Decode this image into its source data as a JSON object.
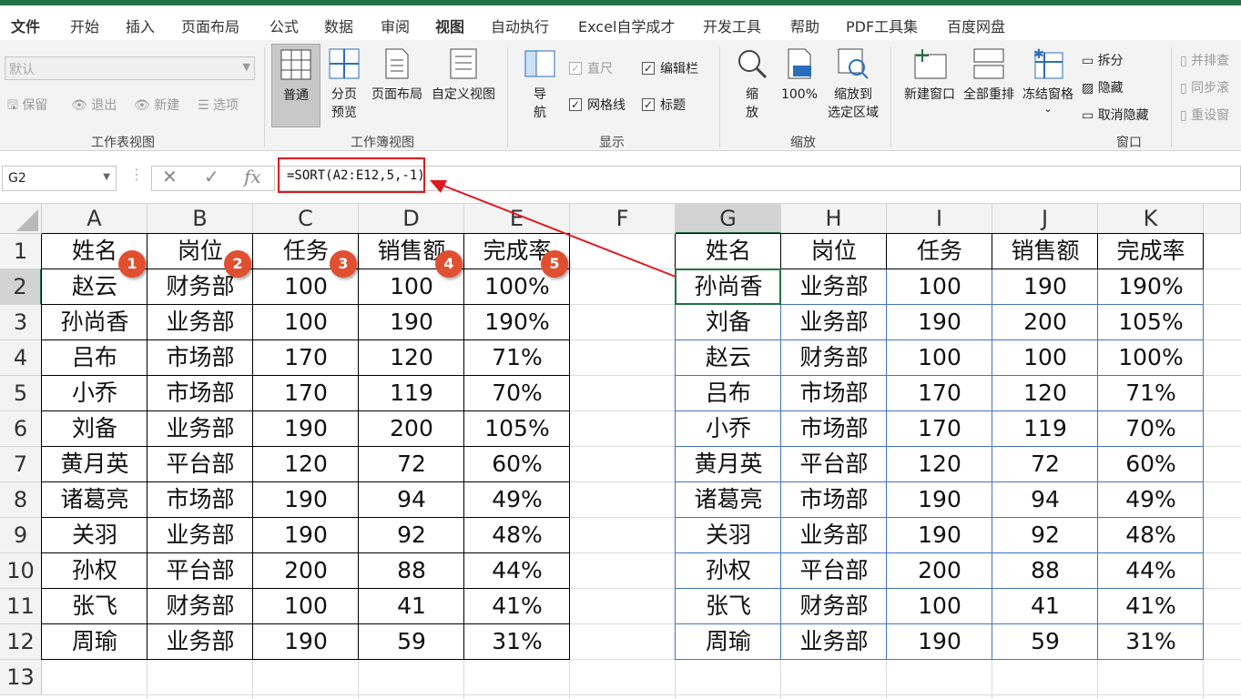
{
  "tabs": [
    "文件",
    "开始",
    "插入",
    "页面布局",
    "公式",
    "数据",
    "审阅",
    "视图",
    "自动执行",
    "Excel自学成才",
    "开发工具",
    "帮助",
    "PDF工具集",
    "百度网盘"
  ],
  "active_tab": "视图",
  "ribbon": {
    "sheet_view": {
      "combo_value": "默认",
      "keep": "保留",
      "exit": "退出",
      "new": "新建",
      "options": "选项",
      "group_label": "工作表视图"
    },
    "workbook_views": {
      "normal": "普通",
      "page_break": "分页\n预览",
      "page_layout": "页面布局",
      "custom": "自定义视图",
      "group_label": "工作簿视图"
    },
    "show": {
      "nav": "导\n航",
      "ruler": "直尺",
      "formula_bar": "编辑栏",
      "gridlines": "网格线",
      "headings": "标题",
      "group_label": "显示"
    },
    "zoom": {
      "zoom": "缩\n放",
      "hundred": "100%",
      "zoom_to_selection": "缩放到\n选定区域",
      "group_label": "缩放"
    },
    "window": {
      "new_window": "新建窗口",
      "arrange_all": "全部重排",
      "freeze": "冻结窗格",
      "split": "拆分",
      "hide": "隐藏",
      "unhide": "取消隐藏",
      "side_by_side": "并排查",
      "sync_scroll": "同步滚",
      "reset_position": "重设窗",
      "group_label": "窗口"
    }
  },
  "formula_bar": {
    "name_box": "G2",
    "formula": "=SORT(A2:E12,5,-1)"
  },
  "columns": [
    "A",
    "B",
    "C",
    "D",
    "E",
    "F",
    "G",
    "H",
    "I",
    "J",
    "K"
  ],
  "rows": [
    "1",
    "2",
    "3",
    "4",
    "5",
    "6",
    "7",
    "8",
    "9",
    "10",
    "11",
    "12",
    "13"
  ],
  "left_table": {
    "headers": [
      "姓名",
      "岗位",
      "任务",
      "销售额",
      "完成率"
    ],
    "rows": [
      [
        "赵云",
        "财务部",
        "100",
        "100",
        "100%"
      ],
      [
        "孙尚香",
        "业务部",
        "100",
        "190",
        "190%"
      ],
      [
        "吕布",
        "市场部",
        "170",
        "120",
        "71%"
      ],
      [
        "小乔",
        "市场部",
        "170",
        "119",
        "70%"
      ],
      [
        "刘备",
        "业务部",
        "190",
        "200",
        "105%"
      ],
      [
        "黄月英",
        "平台部",
        "120",
        "72",
        "60%"
      ],
      [
        "诸葛亮",
        "市场部",
        "190",
        "94",
        "49%"
      ],
      [
        "关羽",
        "业务部",
        "190",
        "92",
        "48%"
      ],
      [
        "孙权",
        "平台部",
        "200",
        "88",
        "44%"
      ],
      [
        "张飞",
        "财务部",
        "100",
        "41",
        "41%"
      ],
      [
        "周瑜",
        "业务部",
        "190",
        "59",
        "31%"
      ]
    ]
  },
  "right_table": {
    "headers": [
      "姓名",
      "岗位",
      "任务",
      "销售额",
      "完成率"
    ],
    "rows": [
      [
        "孙尚香",
        "业务部",
        "100",
        "190",
        "190%"
      ],
      [
        "刘备",
        "业务部",
        "190",
        "200",
        "105%"
      ],
      [
        "赵云",
        "财务部",
        "100",
        "100",
        "100%"
      ],
      [
        "吕布",
        "市场部",
        "170",
        "120",
        "71%"
      ],
      [
        "小乔",
        "市场部",
        "170",
        "119",
        "70%"
      ],
      [
        "黄月英",
        "平台部",
        "120",
        "72",
        "60%"
      ],
      [
        "诸葛亮",
        "市场部",
        "190",
        "94",
        "49%"
      ],
      [
        "关羽",
        "业务部",
        "190",
        "92",
        "48%"
      ],
      [
        "孙权",
        "平台部",
        "200",
        "88",
        "44%"
      ],
      [
        "张飞",
        "财务部",
        "100",
        "41",
        "41%"
      ],
      [
        "周瑜",
        "业务部",
        "190",
        "59",
        "31%"
      ]
    ]
  },
  "badges": [
    "1",
    "2",
    "3",
    "4",
    "5"
  ],
  "colors": {
    "accent": "#217346",
    "badge": "#e04f30",
    "highlight": "#e0191f",
    "table_border": "#4472c4"
  }
}
